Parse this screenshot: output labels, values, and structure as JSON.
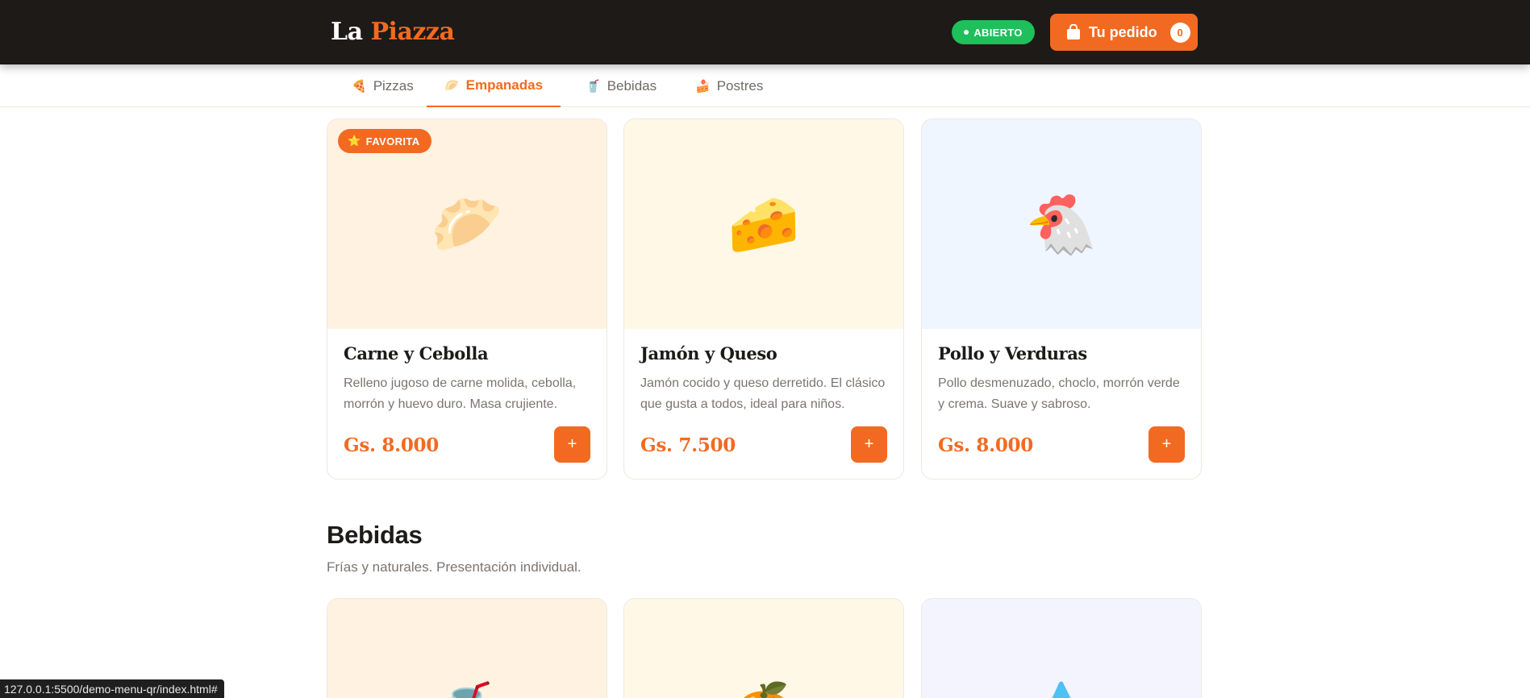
{
  "header": {
    "brand_first": "La",
    "brand_second": "Piazza",
    "status_label": "ABIERTO",
    "order_label": "Tu pedido",
    "order_count": "0"
  },
  "tabs": [
    {
      "icon": "🍕",
      "icon_name": "pizza-icon",
      "label": "Pizzas",
      "active": false
    },
    {
      "icon": "🥟",
      "icon_name": "empanada-icon",
      "label": "Empanadas",
      "active": true
    },
    {
      "icon": "🥤",
      "icon_name": "cup-icon",
      "label": "Bebidas",
      "active": false
    },
    {
      "icon": "🍰",
      "icon_name": "cake-icon",
      "label": "Postres",
      "active": false
    }
  ],
  "empanadas": [
    {
      "badge": "FAVORITA",
      "emoji": "🥟",
      "icon_name": "empanada-icon",
      "name": "Carne y Cebolla",
      "description": "Relleno jugoso de carne molida, cebolla, morrón y huevo duro. Masa crujiente.",
      "price": "Gs. 8.000",
      "add_label": "+",
      "bg": "#fff2e0"
    },
    {
      "badge": "",
      "emoji": "🧀",
      "icon_name": "cheese-icon",
      "name": "Jamón y Queso",
      "description": "Jamón cocido y queso derretido. El clásico que gusta a todos, ideal para niños.",
      "price": "Gs. 7.500",
      "add_label": "+",
      "bg": "#fff8e6"
    },
    {
      "badge": "",
      "emoji": "🐔",
      "icon_name": "chicken-icon",
      "name": "Pollo y Verduras",
      "description": "Pollo desmenuzado, choclo, morrón verde y crema. Suave y sabroso.",
      "price": "Gs. 8.000",
      "add_label": "+",
      "bg": "#eff6ff"
    }
  ],
  "bebidas_section": {
    "title": "Bebidas",
    "subtitle": "Frías y naturales. Presentación individual.",
    "items": [
      {
        "emoji": "🥤",
        "icon_name": "cup-with-straw-icon",
        "bg": "#fff2e0"
      },
      {
        "emoji": "🍊",
        "icon_name": "orange-icon",
        "bg": "#fff8e6"
      },
      {
        "emoji": "💧",
        "icon_name": "water-drop-icon",
        "bg": "#f3f4fe"
      }
    ]
  },
  "statusbar": {
    "url": "127.0.0.1:5500/demo-menu-qr/index.html#"
  },
  "colors": {
    "accent": "#f26a21",
    "header_bg": "#1d1a18",
    "open_green": "#1fbf5b"
  }
}
